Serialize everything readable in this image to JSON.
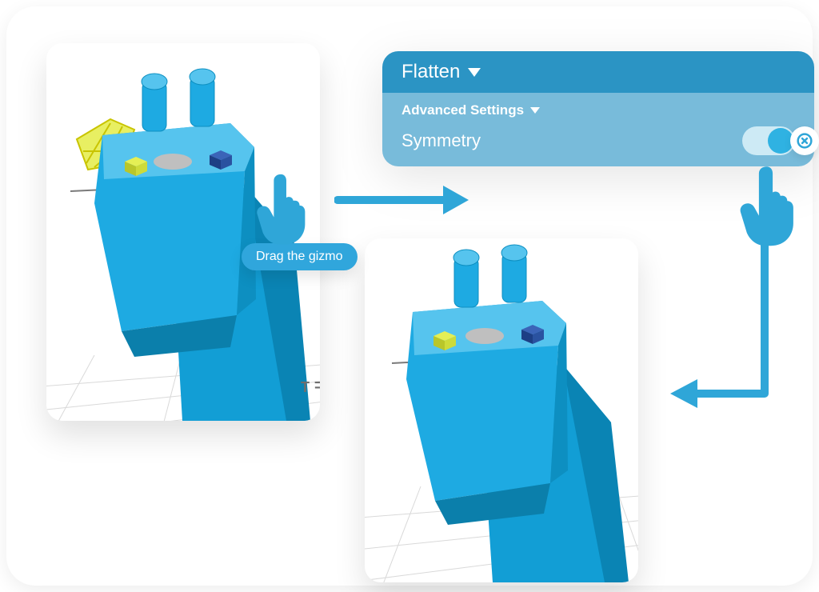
{
  "panel": {
    "header_label": "Flatten",
    "section_label": "Advanced Settings",
    "option_label": "Symmetry",
    "toggle_state": "on"
  },
  "tooltip": {
    "text": "Drag the gizmo"
  },
  "viewport_marker_text": "EFT",
  "colors": {
    "brand_primary": "#2b94c4",
    "brand_light": "#78bbda",
    "accent": "#30a6dc",
    "model_fill": "#1eaae2",
    "gizmo_yellow": "#d6e545",
    "gizmo_blue": "#2353a3"
  },
  "icons": {
    "dropdown": "triangle-down",
    "close": "x-circle",
    "pointer": "pointing-hand"
  }
}
